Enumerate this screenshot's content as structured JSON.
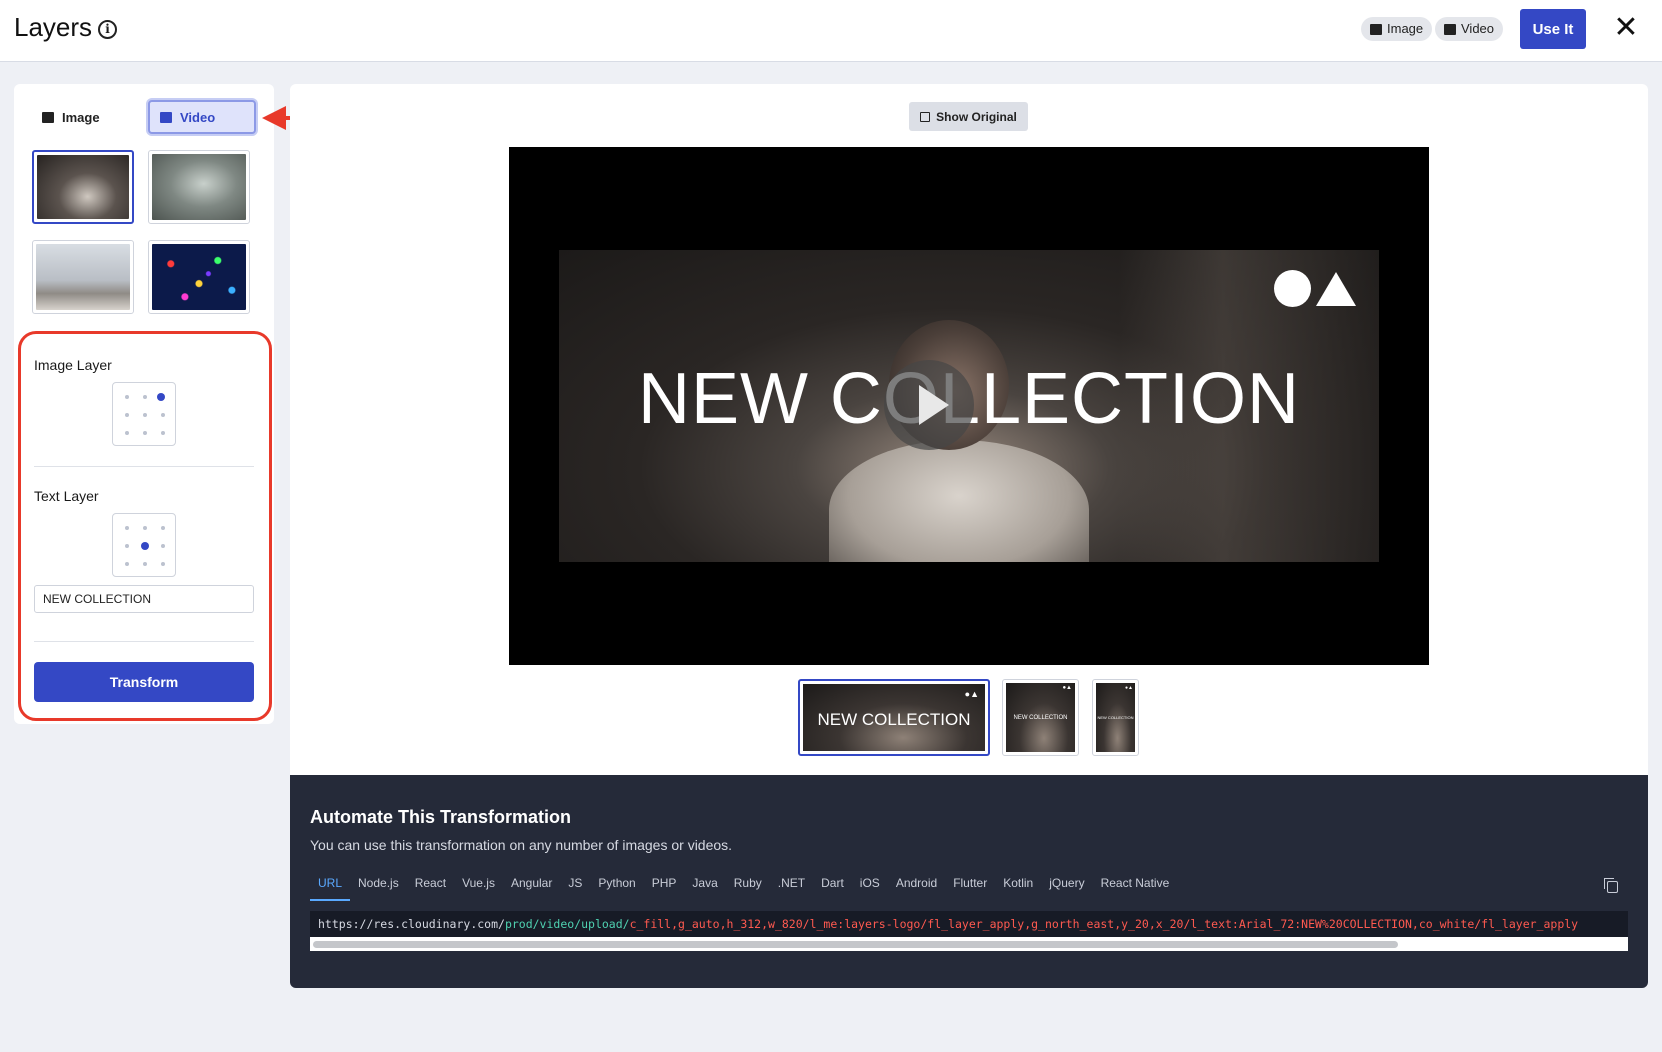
{
  "header": {
    "title": "Layers",
    "pills": [
      {
        "label": "Image",
        "icon": "image-icon"
      },
      {
        "label": "Video",
        "icon": "video-icon"
      }
    ],
    "use_it_label": "Use It",
    "close_glyph": "✕"
  },
  "sidebar": {
    "tabs": [
      {
        "label": "Image",
        "icon": "image-icon",
        "active": false
      },
      {
        "label": "Video",
        "icon": "video-icon",
        "active": true
      }
    ],
    "image_layer_label": "Image Layer",
    "text_layer_label": "Text Layer",
    "text_value": "NEW COLLECTION",
    "image_layer_position": "top-right",
    "text_layer_position": "center",
    "transform_label": "Transform"
  },
  "preview": {
    "show_original_label": "Show Original",
    "overlay_text": "NEW COLLECTION",
    "thumbnails": [
      {
        "text": "NEW COLLECTION",
        "selected": true
      },
      {
        "text": "NEW COLLECTION",
        "selected": false
      },
      {
        "text": "NEW COLLECTION",
        "selected": false
      }
    ]
  },
  "code": {
    "title": "Automate This Transformation",
    "subtitle": "You can use this transformation on any number of images or videos.",
    "tabs": [
      "URL",
      "Node.js",
      "React",
      "Vue.js",
      "Angular",
      "JS",
      "Python",
      "PHP",
      "Java",
      "Ruby",
      ".NET",
      "Dart",
      "iOS",
      "Android",
      "Flutter",
      "Kotlin",
      "jQuery",
      "React Native"
    ],
    "active_tab": "URL",
    "url_base": "https://res.cloudinary.com/",
    "url_path": "prod/video/upload/",
    "url_transform": "c_fill,g_auto,h_312,w_820/l_me:layers-logo/fl_layer_apply,g_north_east,y_20,x_20/l_text:Arial_72:NEW%20COLLECTION,co_white/fl_layer_apply"
  },
  "colors": {
    "accent": "#3448c5",
    "annotation": "#e8392a",
    "code_bg": "#252a39",
    "url_path": "#4fd1b1",
    "url_transform": "#ff5a50"
  }
}
